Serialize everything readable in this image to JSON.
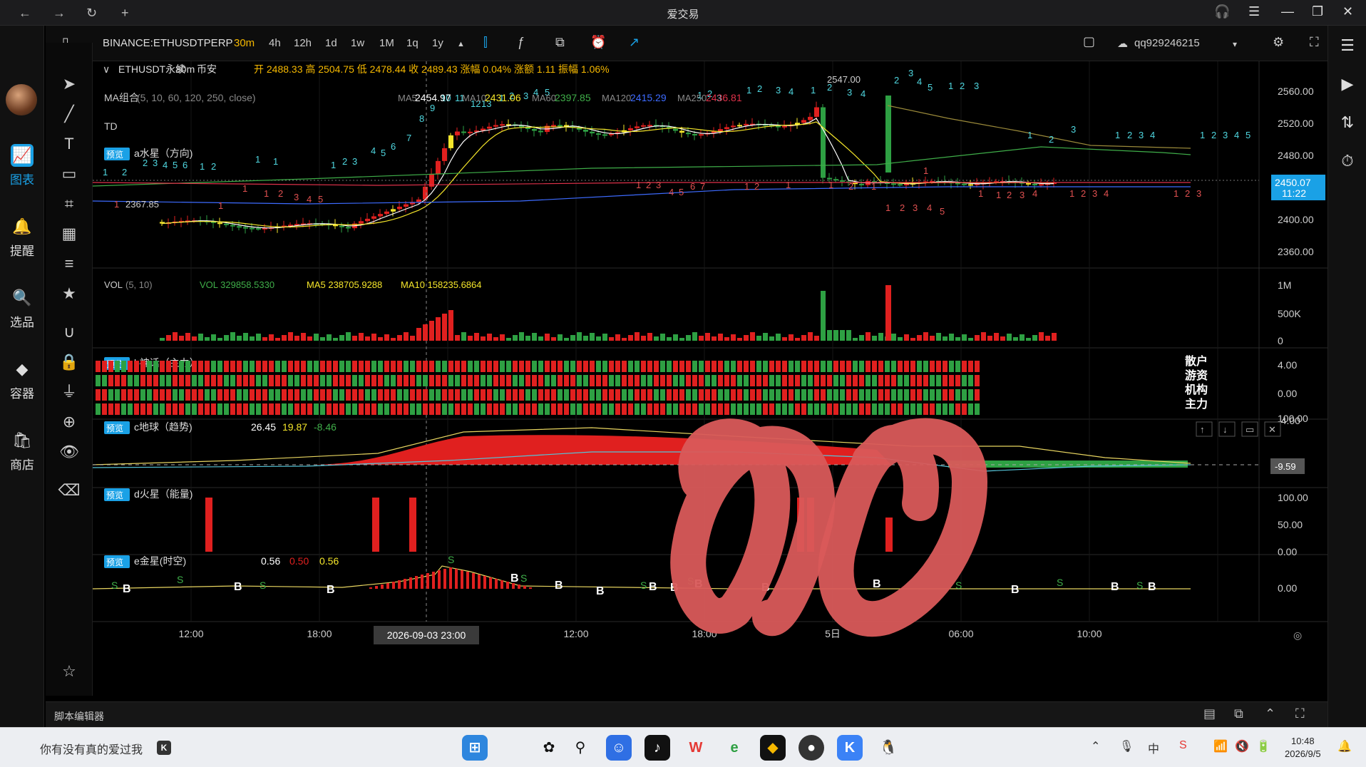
{
  "window": {
    "title": "爱交易"
  },
  "leftbar": {
    "items": [
      {
        "label": "图表",
        "icon": "chart-icon",
        "active": true
      },
      {
        "label": "提醒",
        "icon": "bell-icon"
      },
      {
        "label": "选品",
        "icon": "select-icon"
      },
      {
        "label": "容器",
        "icon": "container-icon"
      },
      {
        "label": "商店",
        "icon": "store-icon"
      }
    ]
  },
  "topbar": {
    "symbol": "BINANCE:ETHUSDTPERP",
    "intervals": [
      "30m",
      "4h",
      "12h",
      "1d",
      "1w",
      "1M",
      "1q",
      "1y"
    ],
    "active_interval": "30m",
    "user": "qq929246215"
  },
  "header": {
    "name": "ETHUSDT永续",
    "interval": "30m",
    "exchange": "币安",
    "ohlc": "开 2488.33 高 2504.75 低 2478.44 收 2489.43 涨幅 0.04% 涨额 1.11 振幅 1.06%"
  },
  "ma": {
    "label": "MA组合",
    "params": "(5, 10, 60, 120, 250, close)",
    "items": [
      {
        "name": "MA5",
        "value": "2454.97",
        "color": "#ffffff"
      },
      {
        "name": "MA10",
        "value": "2431.06",
        "color": "#f5e62a"
      },
      {
        "name": "MA60",
        "value": "2397.85",
        "color": "#3fae49"
      },
      {
        "name": "MA120",
        "value": "2415.29",
        "color": "#3d6bff"
      },
      {
        "name": "MA250",
        "value": "2436.81",
        "color": "#e0314a"
      }
    ]
  },
  "td": {
    "label": "TD"
  },
  "water": {
    "badge": "预览",
    "label": "a水星（方向)"
  },
  "price_axis": {
    "labels": [
      "2560.00",
      "2520.00",
      "2480.00",
      "2440.00",
      "2400.00",
      "2360.00"
    ],
    "current": "2450.07",
    "current_time": "11:22"
  },
  "annot": {
    "high": "2547.00",
    "low": "2367.85"
  },
  "vol": {
    "label": "VOL",
    "params": "(5, 10)",
    "vol": "VOL 329858.5330",
    "ma5": "MA5 238705.9288",
    "ma10": "MA10 158235.6864",
    "axis": [
      "1M",
      "500K",
      "0"
    ]
  },
  "b": {
    "badge": "预览",
    "label": "b神话（主力）",
    "axis": [
      "4.00",
      "0.00",
      "-4.00"
    ],
    "legend": [
      "散户",
      "游资",
      "机构",
      "主力"
    ]
  },
  "c": {
    "badge": "预览",
    "label": "c地球（趋势)",
    "v1": "26.45",
    "v2": "19.87",
    "v3": "-8.46",
    "axis": [
      "100.00"
    ],
    "current": "-9.59"
  },
  "d": {
    "badge": "预览",
    "label": "d火星（能量)",
    "axis": [
      "100.00",
      "50.00",
      "0.00"
    ]
  },
  "e": {
    "badge": "预览",
    "label": "e金星(时空)",
    "v1": "0.56",
    "v2": "0.50",
    "v3": "0.56",
    "axis": [
      "0.00"
    ],
    "b_marker": "B",
    "s_marker": "S"
  },
  "time_axis": {
    "labels": [
      "12:00",
      "18:00",
      "06:00",
      "12:00",
      "18:00",
      "5日",
      "06:00",
      "10:00"
    ],
    "crosshair": "2026-09-03   23:00"
  },
  "script_editor": {
    "label": "脚本编辑器"
  },
  "taskbar": {
    "search": "你有没有真的爱过我",
    "time": "10:48",
    "date": "2026/9/5",
    "ime": "中"
  }
}
